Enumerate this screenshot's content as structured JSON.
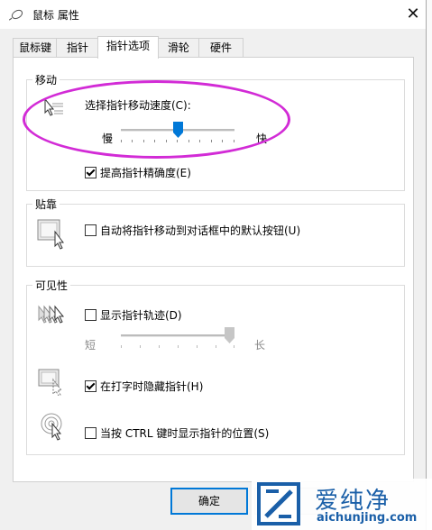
{
  "window": {
    "title": "鼠标 属性",
    "close_glyph": "✕"
  },
  "tabs": [
    {
      "label": "鼠标键",
      "active": false
    },
    {
      "label": "指针",
      "active": false
    },
    {
      "label": "指针选项",
      "active": true
    },
    {
      "label": "滑轮",
      "active": false
    },
    {
      "label": "硬件",
      "active": false
    }
  ],
  "motion": {
    "group_title": "移动",
    "speed_label": "选择指针移动速度(C):",
    "slow": "慢",
    "fast": "快",
    "speed_level": 0.5,
    "precision_label": "提高指针精确度(E)",
    "precision_checked": true
  },
  "snap": {
    "group_title": "贴靠",
    "snap_label": "自动将指针移动到对话框中的默认按钮(U)",
    "snap_checked": false
  },
  "visibility": {
    "group_title": "可见性",
    "trails_label": "显示指针轨迹(D)",
    "trails_checked": false,
    "short": "短",
    "long": "长",
    "trails_level": 1.0,
    "hide_label": "在打字时隐藏指针(H)",
    "hide_checked": true,
    "ctrl_label": "当按 CTRL 键时显示指针的位置(S)",
    "ctrl_checked": false
  },
  "buttons": {
    "ok": "确定"
  },
  "watermark": {
    "brand": "爱纯净",
    "url": "aichunjing.com"
  },
  "colors": {
    "highlight": "#d22bd6",
    "accent": "#0078d7",
    "watermark": "#1a5fa8"
  }
}
